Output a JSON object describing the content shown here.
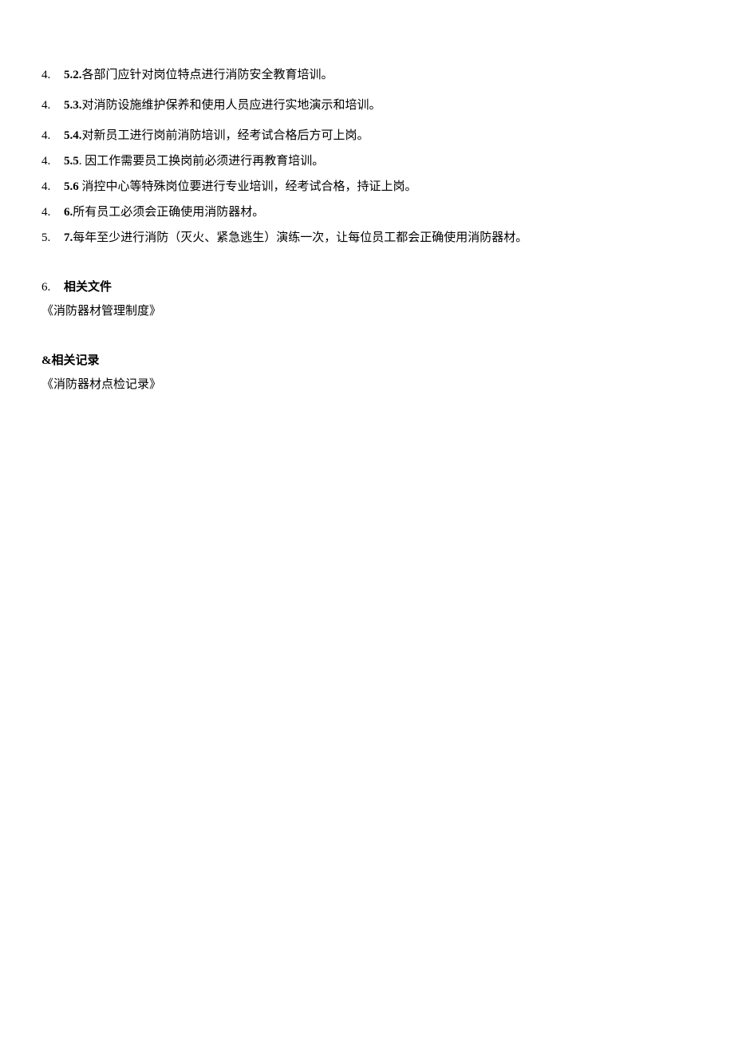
{
  "items": [
    {
      "prefix": "4.",
      "label": "5.2.",
      "text": "各部门应针对岗位特点进行消防安全教育培训。"
    },
    {
      "prefix": "4.",
      "label": "5.3.",
      "text": "对消防设施维护保养和使用人员应进行实地演示和培训。"
    },
    {
      "prefix": "4.",
      "label": "5.4.",
      "text": "对新员工进行岗前消防培训，经考试合格后方可上岗。"
    },
    {
      "prefix": "4.",
      "label": "5.5",
      "text": ". 因工作需要员工换岗前必须进行再教育培训。"
    },
    {
      "prefix": "4.",
      "label": "5.6",
      "text": " 消控中心等特殊岗位要进行专业培训，经考试合格，持证上岗。"
    },
    {
      "prefix": "4.",
      "label": "6.",
      "text": "所有员工必须会正确使用消防器材。"
    },
    {
      "prefix": "5.",
      "label": "7.",
      "text": "每年至少进行消防（灭火、紧急逃生）演练一次，让每位员工都会正确使用消防器材。"
    }
  ],
  "section6": {
    "num": "6.",
    "title": "相关文件",
    "body": "《消防器材管理制度》"
  },
  "section7": {
    "amp": "&",
    "title": "相关记录",
    "body": "《消防器材点检记录》"
  }
}
